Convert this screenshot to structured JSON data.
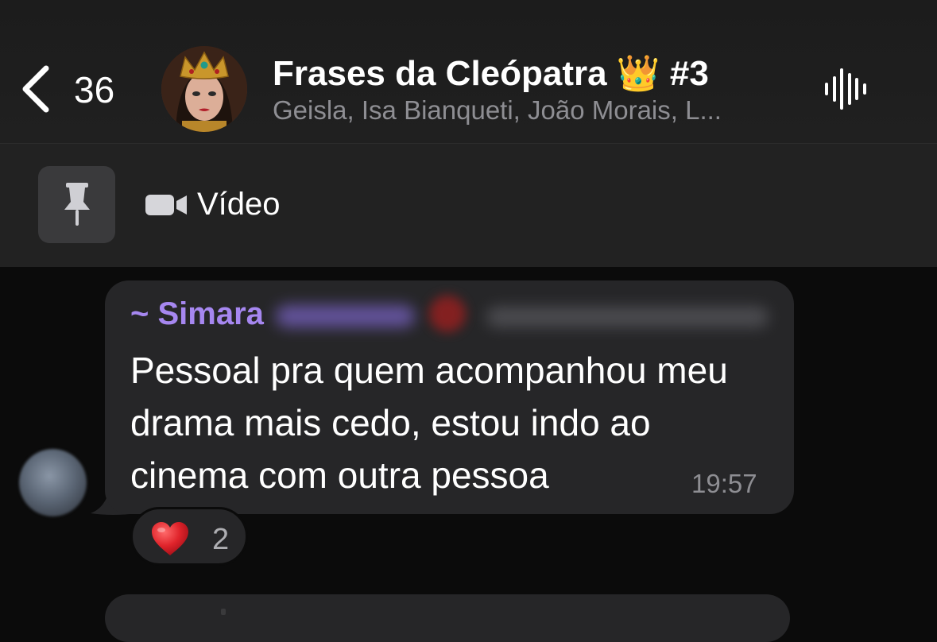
{
  "header": {
    "back_count": "36",
    "title": "Frases da Cleópatra 👑 #3",
    "members": "Geisla, Isa Bianqueti, João Morais, L..."
  },
  "icons": {
    "back": "chevron-left-icon",
    "voice_chat": "audio-waveform-icon",
    "pin": "pushpin-icon",
    "video": "video-camera-icon",
    "reaction": "red-heart-emoji"
  },
  "pinned": {
    "label": "Vídeo"
  },
  "message": {
    "sender_name": "~ Simara",
    "text": "Pessoal pra quem acompanhou meu drama mais cedo, estou indo ao cinema com outra pessoa",
    "time": "19:57",
    "reaction_emoji": "❤️",
    "reaction_count": "2"
  },
  "colors": {
    "background": "#0b0b0b",
    "header": "#1f1f1f",
    "bubble": "#262628",
    "sender_name": "#a687f0",
    "secondary_text": "#8e8e93",
    "heart": "#e0242b"
  }
}
